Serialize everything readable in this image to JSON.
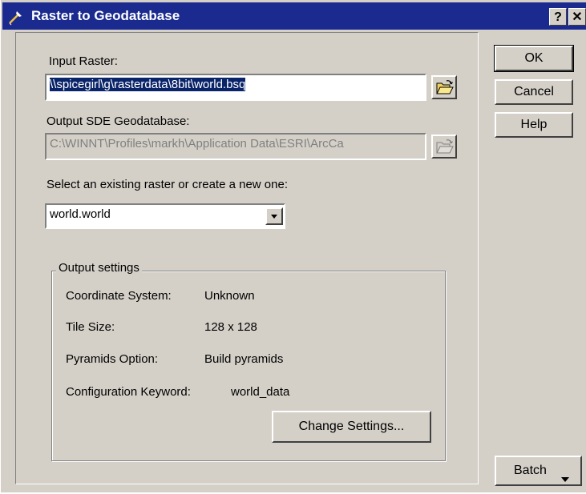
{
  "window": {
    "title": "Raster to Geodatabase",
    "help_button": "?",
    "close_button": "✕"
  },
  "input_raster": {
    "label": "Input Raster:",
    "value": "\\\\spicegirl\\g\\rasterdata\\8bit\\world.bsq"
  },
  "output_geodatabase": {
    "label": "Output SDE Geodatabase:",
    "value": "C:\\WINNT\\Profiles\\markh\\Application Data\\ESRI\\ArcCa"
  },
  "raster_select": {
    "label": "Select an existing raster or create a new one:",
    "value": "world.world"
  },
  "output_settings": {
    "title": "Output settings",
    "rows": [
      {
        "label": "Coordinate System:",
        "value": "Unknown"
      },
      {
        "label": "Tile Size:",
        "value": "128 x 128"
      },
      {
        "label": "Pyramids Option:",
        "value": "Build pyramids"
      },
      {
        "label": "Configuration Keyword:",
        "value": "world_data"
      }
    ],
    "change_button": "Change Settings..."
  },
  "buttons": {
    "ok": "OK",
    "cancel": "Cancel",
    "help": "Help",
    "batch": "Batch"
  },
  "colors": {
    "title_bar": "#1a2a8e",
    "dialog_face": "#d4d0c8",
    "selection": "#0a246a"
  },
  "icons": [
    "tool-icon",
    "folder-open-icon",
    "chevron-down-icon",
    "triangle-down-icon"
  ]
}
